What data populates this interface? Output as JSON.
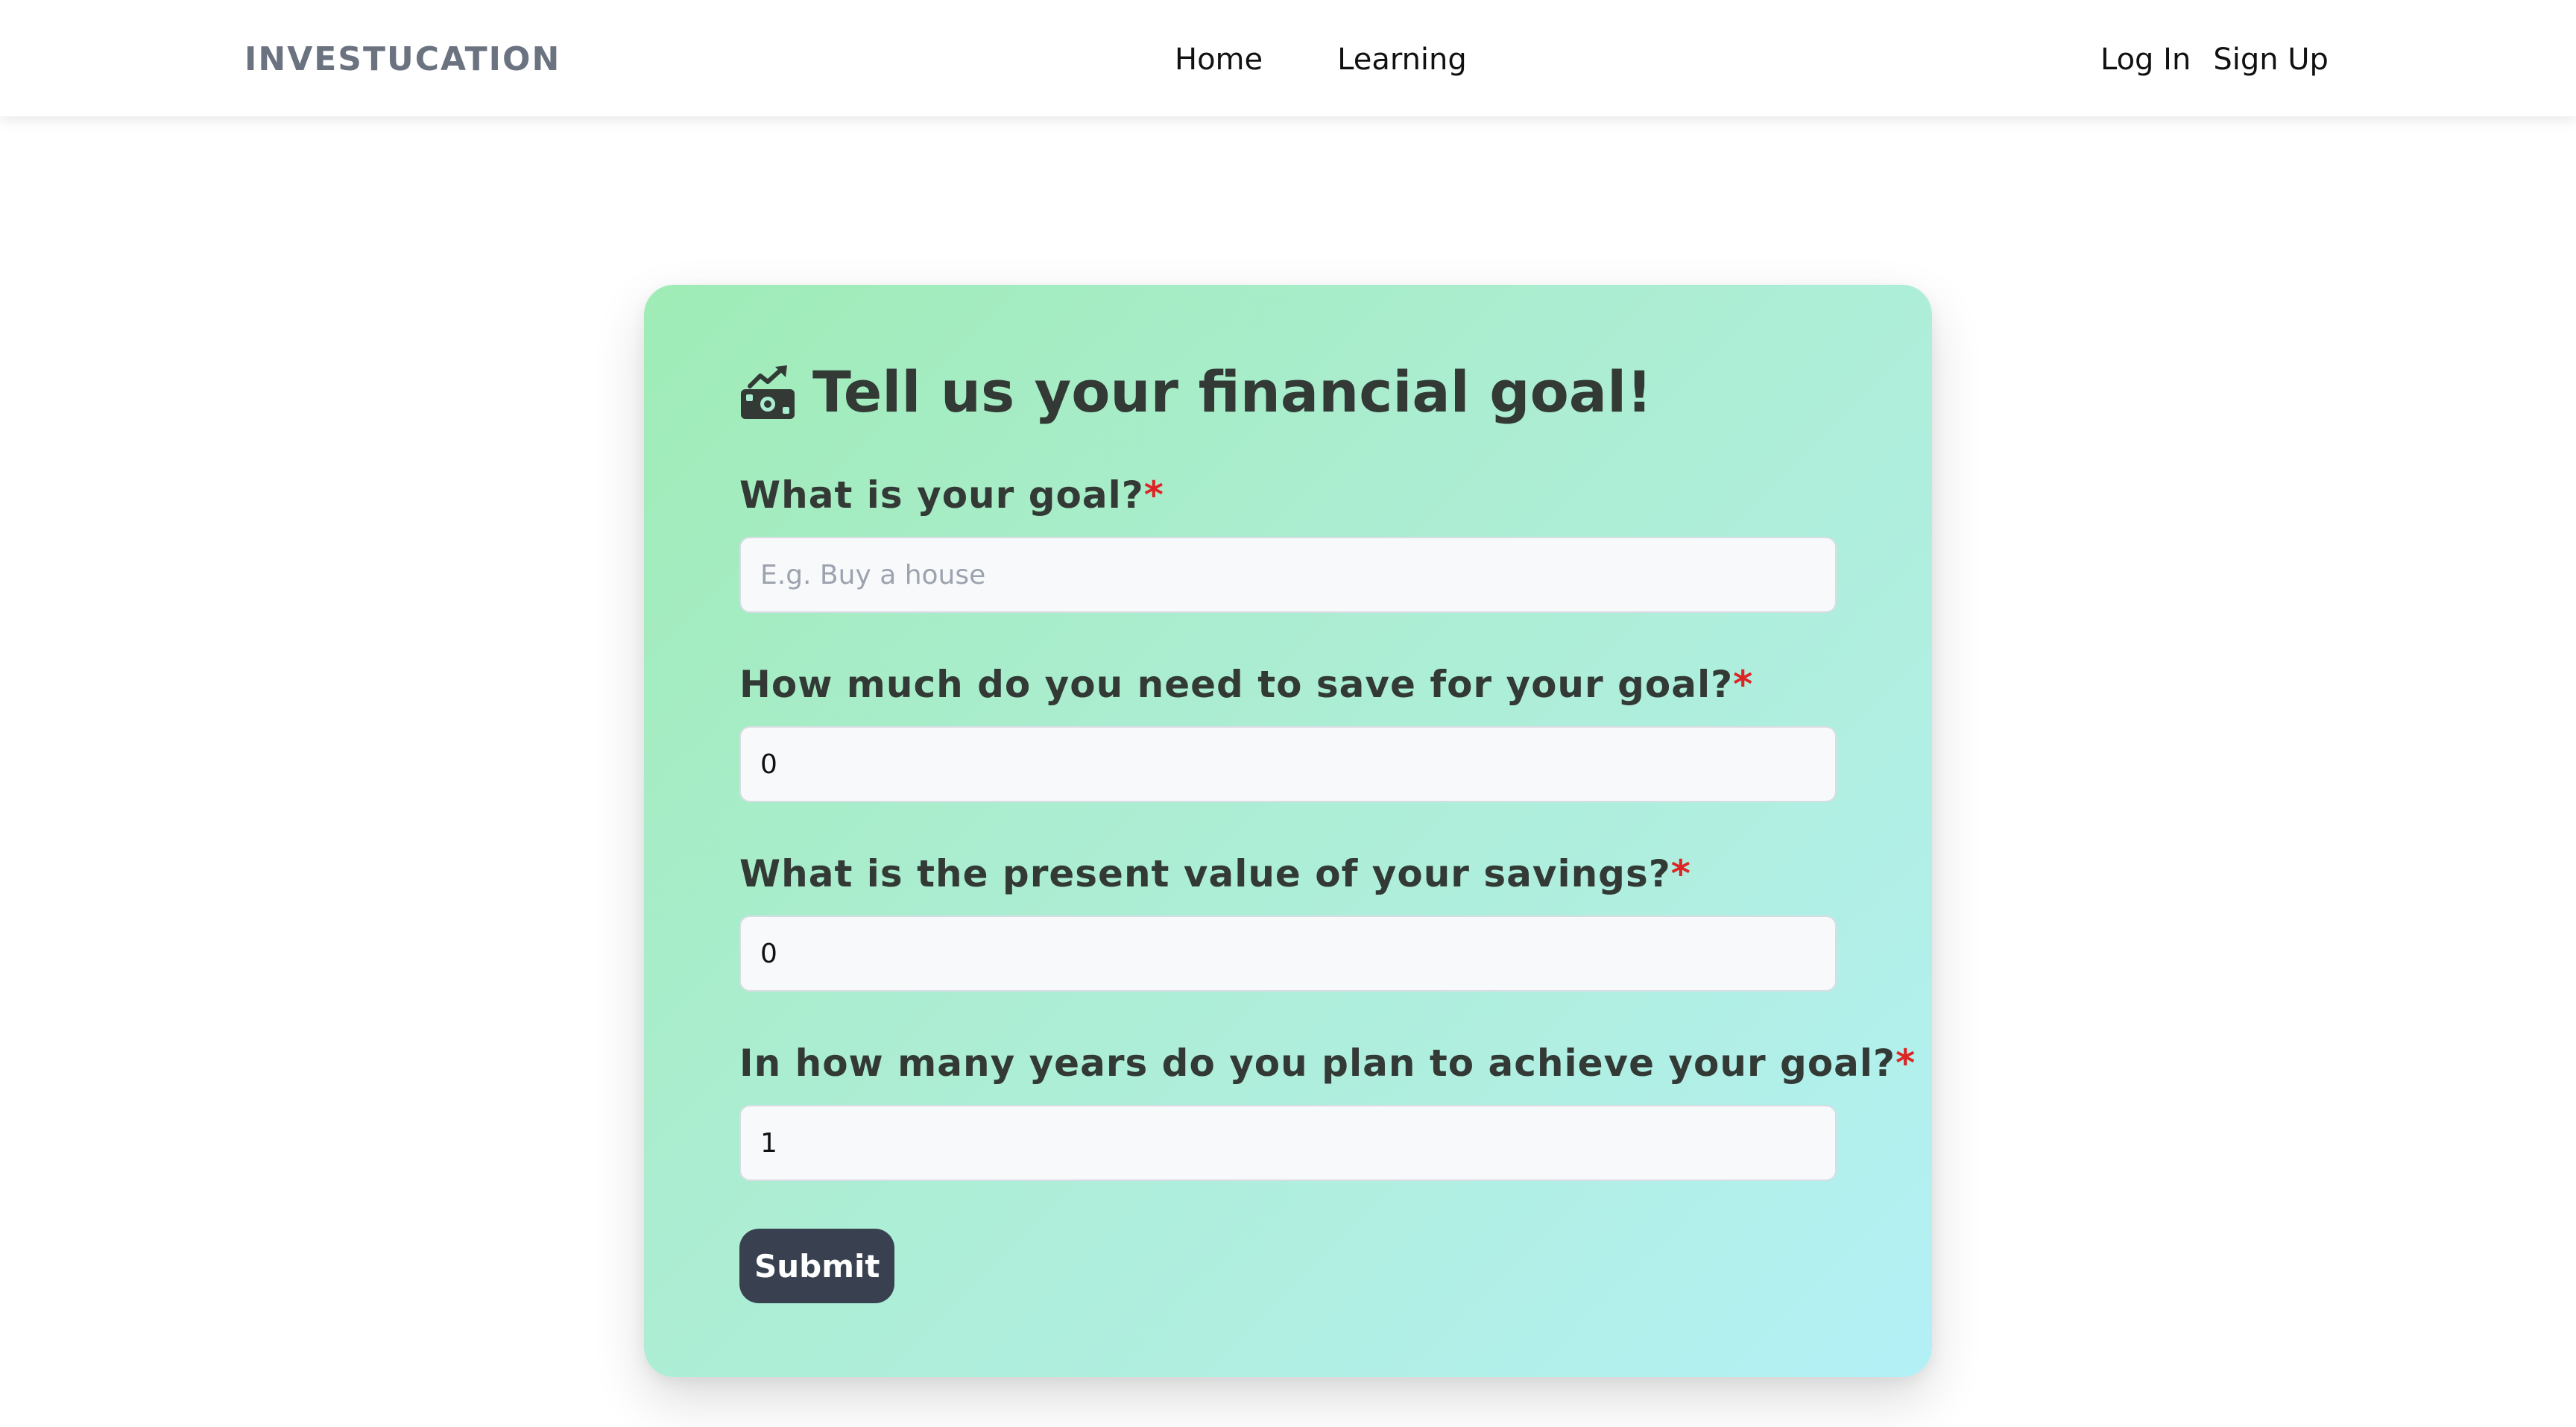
{
  "nav": {
    "brand": "INVESTUCATION",
    "center_links": [
      {
        "label": "Home"
      },
      {
        "label": "Learning"
      }
    ],
    "login_label": "Log In",
    "signup_label": "Sign Up"
  },
  "form": {
    "title": "Tell us your financial goal!",
    "title_icon": "money-growth-icon",
    "required_marker": "*",
    "fields": [
      {
        "label": "What is your goal?",
        "value": "",
        "placeholder": "E.g. Buy a house"
      },
      {
        "label": "How much do you need to save for your goal?",
        "value": "0",
        "placeholder": ""
      },
      {
        "label": "What is the present value of your savings?",
        "value": "0",
        "placeholder": ""
      },
      {
        "label": "In how many years do you plan to achieve your goal?",
        "value": "1",
        "placeholder": ""
      }
    ],
    "submit_label": "Submit"
  },
  "colors": {
    "card_gradient_start": "#9fecb6",
    "card_gradient_end": "#b3f0f7",
    "submit_bg": "#394150",
    "required": "#dc2626",
    "brand": "#6b7280"
  }
}
